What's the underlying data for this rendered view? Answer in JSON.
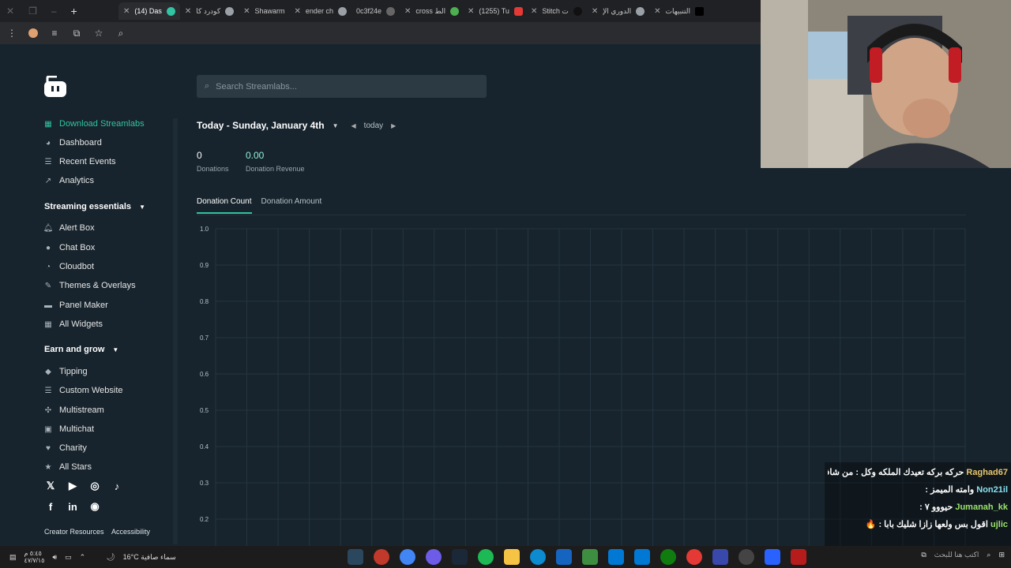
{
  "browser": {
    "tabs": [
      {
        "title": "(14) Das",
        "active": true
      },
      {
        "title": "كودرد كا"
      },
      {
        "title": "Shawarm"
      },
      {
        "title": "ender ch"
      },
      {
        "title": "0c3f24e"
      },
      {
        "title": "cross الط"
      },
      {
        "title": "(1255) Tu"
      },
      {
        "title": "Stitch ت"
      },
      {
        "title": "الدوري الإ"
      },
      {
        "title": "التنبيهات"
      }
    ]
  },
  "search": {
    "placeholder": "Search Streamlabs..."
  },
  "sidebar": {
    "download": "Download Streamlabs",
    "dashboard": "Dashboard",
    "recent_events": "Recent Events",
    "analytics": "Analytics",
    "section1": "Streaming essentials",
    "alert_box": "Alert Box",
    "chat_box": "Chat Box",
    "cloudbot": "Cloudbot",
    "themes": "Themes & Overlays",
    "panel_maker": "Panel Maker",
    "all_widgets": "All Widgets",
    "section2": "Earn and grow",
    "tipping": "Tipping",
    "custom_website": "Custom Website",
    "multistream": "Multistream",
    "multichat": "Multichat",
    "charity": "Charity",
    "all_stars": "All Stars",
    "creator_resources": "Creator Resources",
    "accessibility": "Accessibility"
  },
  "date_nav": {
    "date": "Today - Sunday, January 4th",
    "today": "today"
  },
  "stats": {
    "donations_value": "0",
    "donations_label": "Donations",
    "revenue_value": "0.00",
    "revenue_label": "Donation Revenue"
  },
  "chart_tabs": {
    "count": "Donation Count",
    "amount": "Donation Amount"
  },
  "chart_data": {
    "type": "line",
    "title": "",
    "xlabel": "",
    "ylabel": "",
    "ylim": [
      0.2,
      1.0
    ],
    "y_ticks": [
      "1.0",
      "0.9",
      "0.8",
      "0.7",
      "0.6",
      "0.5",
      "0.4",
      "0.3",
      "0.2"
    ],
    "series": [],
    "grid": true
  },
  "chat": [
    {
      "user": "Raghad67",
      "msg": "حركه بركه تعيدك الملكه وكل : من شاف زوط"
    },
    {
      "user": "Non21il",
      "msg": "وامته الميمز :"
    },
    {
      "user": "Jumanah_kk",
      "msg": "حيووو ٧ : "
    },
    {
      "user": "ujlic",
      "msg": "اقول بس ولعها زازا شليك بابا : 🔥"
    }
  ],
  "taskbar": {
    "weather": "16°C  سماء صافية",
    "time": "٥:٤٥ م",
    "date": "٤٧/٧/١٥",
    "search_placeholder": "اكتب هنا للبحث"
  }
}
